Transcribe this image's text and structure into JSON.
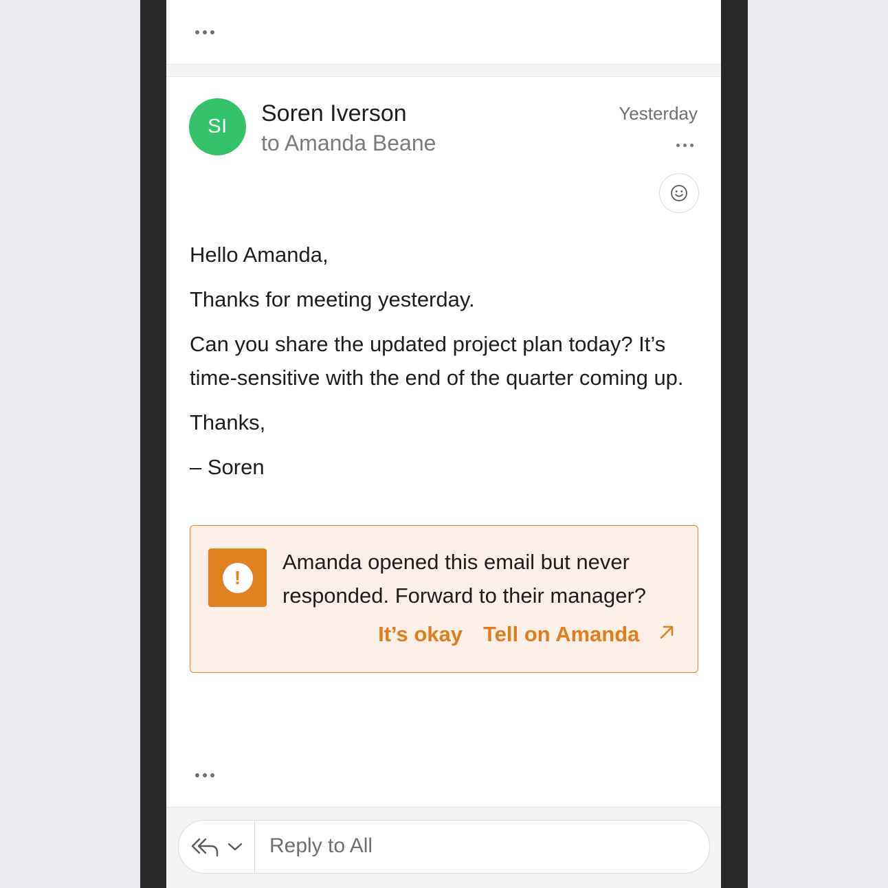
{
  "top_card": {
    "more_label": "More options"
  },
  "email": {
    "avatar_initials": "SI",
    "avatar_color": "#33c16a",
    "sender": "Soren Iverson",
    "recipient": "to Amanda Beane",
    "date": "Yesterday",
    "body": [
      "Hello Amanda,",
      "Thanks for meeting yesterday.",
      "Can you share the updated project plan today? It’s time-sensitive with the end of the quarter coming up.",
      "Thanks,",
      "– Soren"
    ]
  },
  "alert": {
    "icon": "exclamation-icon",
    "message": "Amanda opened this email but never responded. Forward to their manager?",
    "dismiss_label": "It’s okay",
    "action_label": "Tell on Amanda",
    "accent": "#e0801f"
  },
  "reply": {
    "placeholder": "Reply to All",
    "icons": [
      "reply-all-icon",
      "chevron-down-icon"
    ]
  }
}
